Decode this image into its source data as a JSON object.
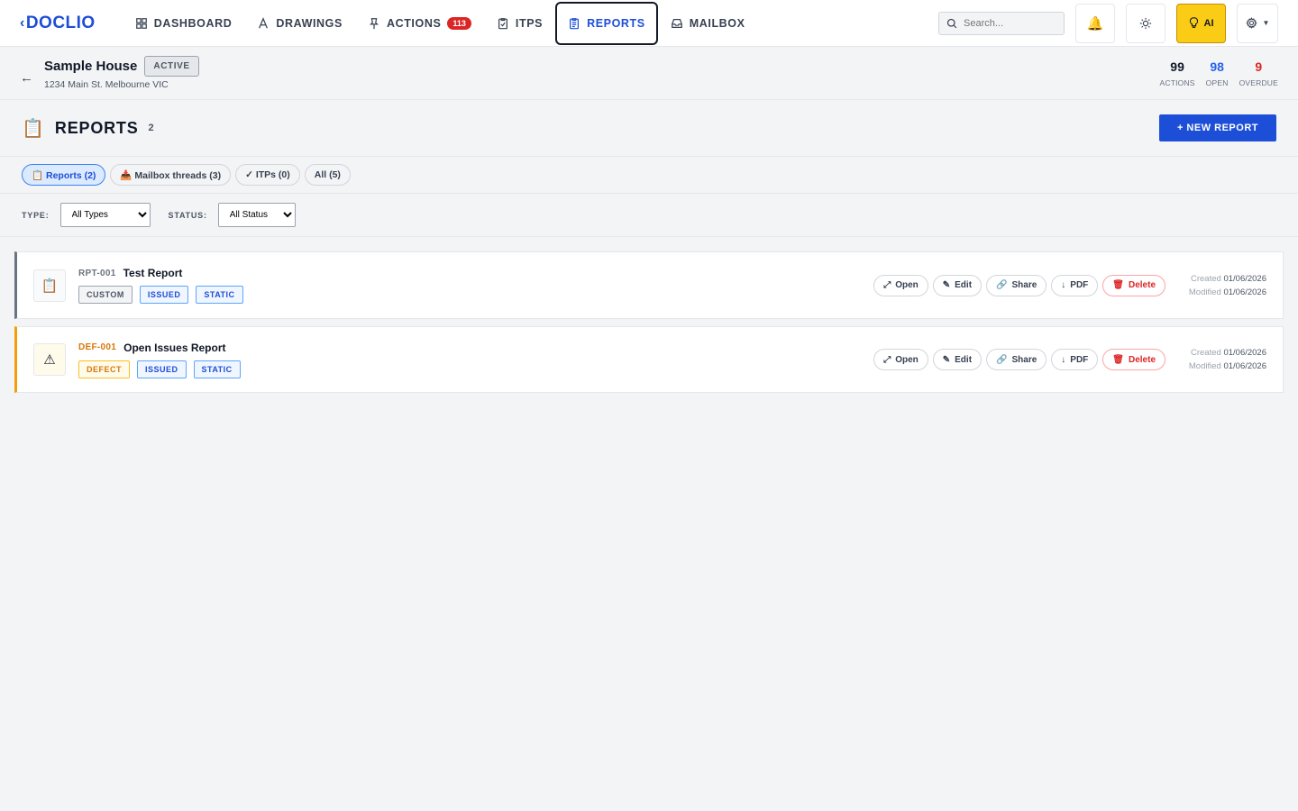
{
  "app": {
    "logo": "DOCLIO"
  },
  "nav": {
    "items": [
      {
        "label": "DASHBOARD",
        "icon": "grid-icon"
      },
      {
        "label": "DRAWINGS",
        "icon": "pen-icon"
      },
      {
        "label": "ACTIONS",
        "icon": "pin-icon",
        "badge": "113"
      },
      {
        "label": "ITPS",
        "icon": "clipboard-check-icon"
      },
      {
        "label": "REPORTS",
        "icon": "clipboard-icon",
        "active": true
      },
      {
        "label": "MAILBOX",
        "icon": "inbox-icon"
      }
    ],
    "search_placeholder": "Search...",
    "ai_label": "AI",
    "accent": "#1d4ed8"
  },
  "project": {
    "name": "Sample House",
    "status": "ACTIVE",
    "address": "1234 Main St. Melbourne VIC",
    "stats": [
      {
        "value": "99",
        "label": "ACTIONS",
        "color": "#111827"
      },
      {
        "value": "98",
        "label": "OPEN",
        "color": "#2563eb"
      },
      {
        "value": "9",
        "label": "OVERDUE",
        "color": "#dc2626"
      }
    ]
  },
  "page": {
    "icon": "📋",
    "title": "REPORTS",
    "count": "2",
    "new_button": "+ NEW REPORT"
  },
  "tabs": [
    {
      "label": "📋 Reports (2)",
      "active": true
    },
    {
      "label": "📥 Mailbox threads (3)"
    },
    {
      "label": "✓ ITPs (0)"
    },
    {
      "label": "All (5)"
    }
  ],
  "filters": {
    "type_label": "TYPE:",
    "type_value": "All Types",
    "status_label": "STATUS:",
    "status_value": "All Status"
  },
  "reports": [
    {
      "icon": "📋",
      "id": "RPT-001",
      "title": "Test Report",
      "tags": [
        "CUSTOM",
        "ISSUED",
        "STATIC"
      ],
      "created_label": "Created",
      "created": "01/06/2026",
      "modified_label": "Modified",
      "modified": "01/06/2026"
    },
    {
      "icon": "⚠",
      "id": "DEF-001",
      "title": "Open Issues Report",
      "tags": [
        "DEFECT",
        "ISSUED",
        "STATIC"
      ],
      "created_label": "Created",
      "created": "01/06/2026",
      "modified_label": "Modified",
      "modified": "01/06/2026"
    }
  ],
  "card_actions": {
    "open": "Open",
    "edit": "Edit",
    "share": "Share",
    "pdf": "PDF",
    "delete": "Delete"
  }
}
